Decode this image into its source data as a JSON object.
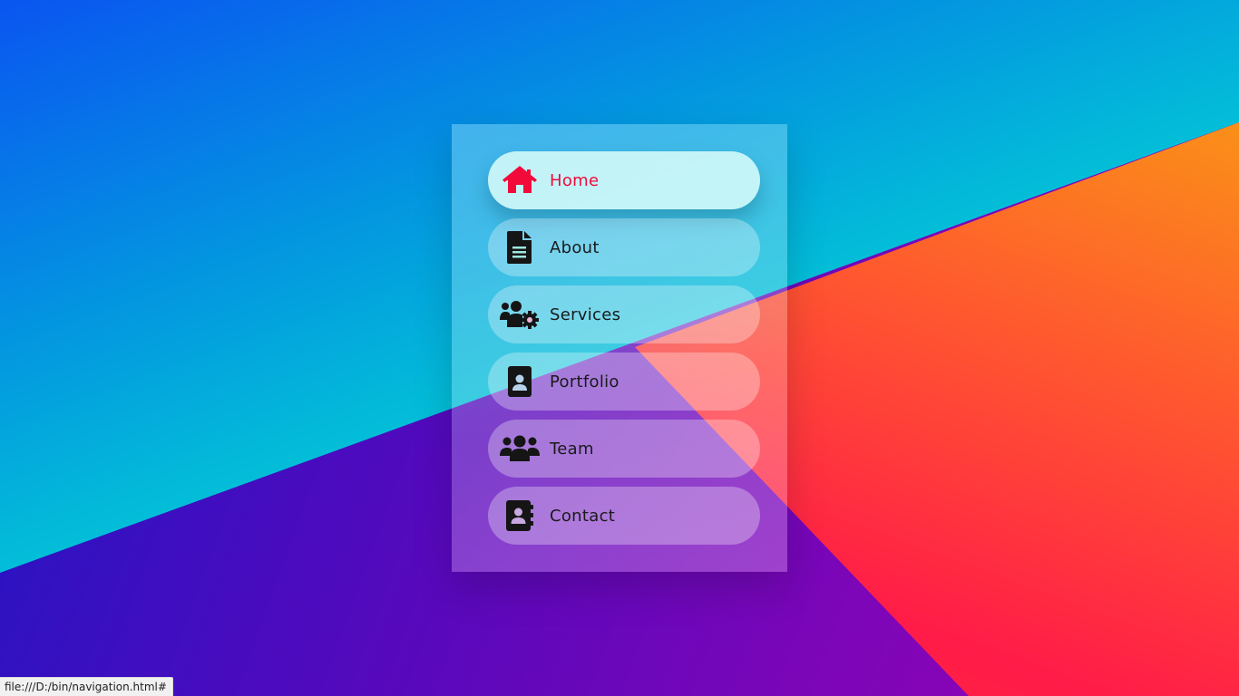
{
  "nav": {
    "items": [
      {
        "label": "Home",
        "icon": "home-icon",
        "active": true
      },
      {
        "label": "About",
        "icon": "document-icon",
        "active": false
      },
      {
        "label": "Services",
        "icon": "users-cog-icon",
        "active": false
      },
      {
        "label": "Portfolio",
        "icon": "portfolio-icon",
        "active": false
      },
      {
        "label": "Team",
        "icon": "team-icon",
        "active": false
      },
      {
        "label": "Contact",
        "icon": "contact-book-icon",
        "active": false
      }
    ]
  },
  "status_bar": {
    "url": "file:///D:/bin/navigation.html#"
  },
  "colors": {
    "active_text": "#f20a3a",
    "text": "#1a1a1a",
    "active_bg": "#cdf8f8"
  }
}
